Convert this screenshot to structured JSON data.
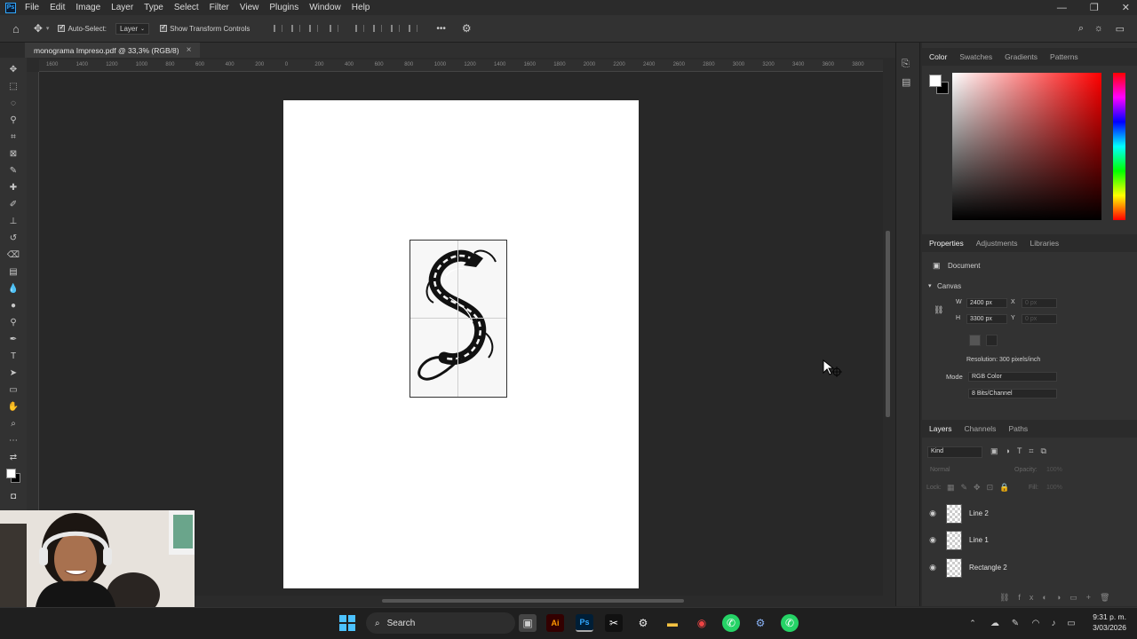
{
  "menubar": {
    "app_icon": "Ps",
    "items": [
      "File",
      "Edit",
      "Image",
      "Layer",
      "Type",
      "Select",
      "Filter",
      "View",
      "Plugins",
      "Window",
      "Help"
    ]
  },
  "options_bar": {
    "auto_select_label": "Auto-Select:",
    "auto_select_target": "Layer",
    "show_transform_label": "Show Transform Controls",
    "more_label": "•••"
  },
  "document_tab": {
    "title": "monograma Impreso.pdf @ 33,3% (RGB/8)",
    "close": "×"
  },
  "ruler_top_ticks": [
    "1600",
    "1400",
    "1200",
    "1000",
    "800",
    "600",
    "400",
    "200",
    "0",
    "200",
    "400",
    "600",
    "800",
    "1000",
    "1200",
    "1400",
    "1600",
    "1800",
    "2000",
    "2200",
    "2400",
    "2600",
    "2800",
    "3000",
    "3200",
    "3400",
    "3600",
    "3800"
  ],
  "color_panel": {
    "tabs": [
      "Color",
      "Swatches",
      "Gradients",
      "Patterns"
    ],
    "active_tab": "Color",
    "hue_color": "#ff0000"
  },
  "properties_panel": {
    "tabs": [
      "Properties",
      "Adjustments",
      "Libraries"
    ],
    "document_label": "Document",
    "canvas_section": "Canvas",
    "width_label": "W",
    "width_value": "2400 px",
    "height_label": "H",
    "height_value": "3300 px",
    "x_label": "X",
    "x_value": "0 px",
    "y_label": "Y",
    "y_value": "0 px",
    "resolution": "Resolution: 300 pixels/inch",
    "mode_label": "Mode",
    "mode_value": "RGB Color",
    "bits_value": "8 Bits/Channel"
  },
  "layers_panel": {
    "tabs": [
      "Layers",
      "Channels",
      "Paths"
    ],
    "filter_label": "Kind",
    "blend_mode": "Normal",
    "opacity_label": "Opacity:",
    "opacity_value": "100%",
    "lock_label": "Lock:",
    "fill_label": "Fill:",
    "fill_value": "100%",
    "layers": [
      {
        "name": "Line 2",
        "visible": true
      },
      {
        "name": "Line 1",
        "visible": true
      },
      {
        "name": "Rectangle 2",
        "visible": true
      }
    ]
  },
  "taskbar": {
    "search_label": "Search",
    "time": "9:31 p. m.",
    "date": "3/03/2026"
  },
  "colors": {
    "accent": "#31a8ff",
    "canvas_bg": "#282828",
    "page_bg": "#ffffff"
  }
}
